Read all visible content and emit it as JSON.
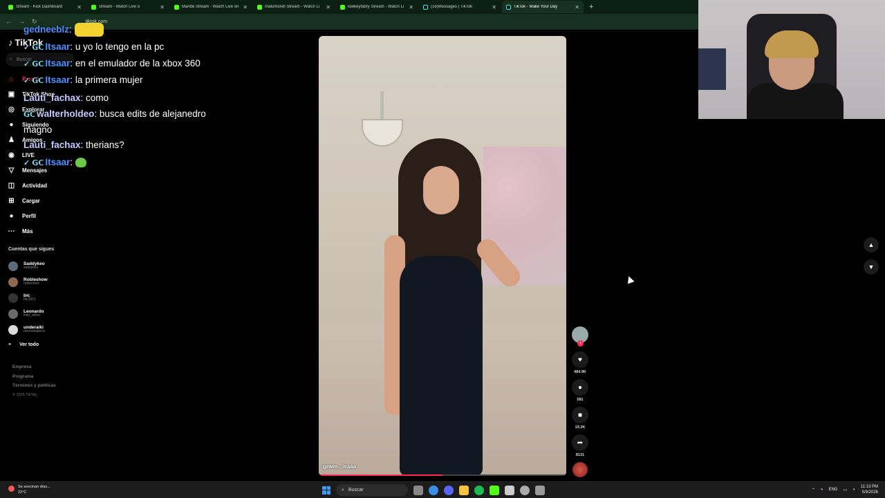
{
  "browser": {
    "tabs": [
      {
        "label": "Stream - Kick Dashboard",
        "icon": "kick-icon",
        "active": false
      },
      {
        "label": "Stream - Watch Live o",
        "icon": "kick-icon",
        "active": false
      },
      {
        "label": "Mantte Stream - Watch Live on",
        "icon": "kick-icon",
        "active": false
      },
      {
        "label": "matumorell Stream - Watch Li",
        "icon": "kick-icon",
        "active": false
      },
      {
        "label": "lowkeyfabry Stream - Watch Li",
        "icon": "kick-icon",
        "active": false
      },
      {
        "label": "(16)Messages | TikTok",
        "icon": "tiktok-icon",
        "active": false
      },
      {
        "label": "TikTok - Make Your Day",
        "icon": "tiktok-icon",
        "active": true
      }
    ],
    "url": "tiktok.com"
  },
  "tiktok": {
    "logo": "TikTok",
    "search_placeholder": "Buscar",
    "menu": [
      {
        "label": "Para ti",
        "icon": "home-icon",
        "active": true
      },
      {
        "label": "TikTok Shop",
        "icon": "shop-bag-icon",
        "active": false
      },
      {
        "label": "Explorar",
        "icon": "compass-icon",
        "active": false
      },
      {
        "label": "Siguiendo",
        "icon": "following-avatar-icon",
        "active": false
      },
      {
        "label": "Amigos",
        "icon": "friends-icon",
        "active": false
      },
      {
        "label": "LIVE",
        "icon": "live-icon",
        "active": false
      },
      {
        "label": "Mensajes",
        "icon": "messages-icon",
        "active": false
      },
      {
        "label": "Actividad",
        "icon": "activity-icon",
        "active": false,
        "badge": "41"
      },
      {
        "label": "Cargar",
        "icon": "upload-icon",
        "active": false
      },
      {
        "label": "Perfil",
        "icon": "profile-icon",
        "active": false
      },
      {
        "label": "Más",
        "icon": "more-icon",
        "active": false
      }
    ],
    "following_title": "Cuentas que sigues",
    "following": [
      {
        "name": "Saddykeo",
        "user": "saddykeo"
      },
      {
        "name": "Robleshow",
        "user": "robleshow"
      },
      {
        "name": "bic",
        "user": "bic3921"
      },
      {
        "name": "Leonardo",
        "user": "leito_setso"
      },
      {
        "name": "underaiki",
        "user": "necesitoperco"
      }
    ],
    "see_all": "Ver todo",
    "footer": [
      "Empresa",
      "Programa",
      "Términos y políticas",
      "© 2026 TikTok"
    ],
    "video": {
      "author": "grwm._isaaa",
      "likes": "484.9K",
      "comments": "581",
      "saves": "19.3K",
      "shares": "8131"
    }
  },
  "chat": [
    {
      "user": "gedneeblz",
      "text": "",
      "color": "#4f8fff",
      "badges": "",
      "emote": "minion"
    },
    {
      "user": "Itsaar",
      "text": "u yo lo tengo en la pc",
      "color": "#4f8fff",
      "badges": "✓ 𝗚𝗖"
    },
    {
      "user": "Itsaar",
      "text": "en el emulador de la xbox 360",
      "color": "#4f8fff",
      "badges": "✓ 𝗚𝗖"
    },
    {
      "user": "Itsaar",
      "text": "la primera mujer",
      "color": "#4f8fff",
      "badges": "✓ 𝗚𝗖"
    },
    {
      "user": "Lauti_fachax",
      "text": "como",
      "color": "#c4cbff",
      "badges": ""
    },
    {
      "user": "walterholdeo",
      "text": "busca edits de alejanedro magno",
      "color": "#c4cbff",
      "badges": "𝗚𝗖"
    },
    {
      "user": "Lauti_fachax",
      "text": "therians?",
      "color": "#c4cbff",
      "badges": ""
    },
    {
      "user": "Itsaar",
      "text": "",
      "color": "#4f8fff",
      "badges": "✓ 𝗚𝗖",
      "emote": "green"
    }
  ],
  "taskbar": {
    "weather_line1": "Se avecinan días...",
    "weather_line2": "22°C",
    "search": "Buscar",
    "lang": "ENG",
    "time": "11:13 PM",
    "date": "5/9/2026"
  }
}
